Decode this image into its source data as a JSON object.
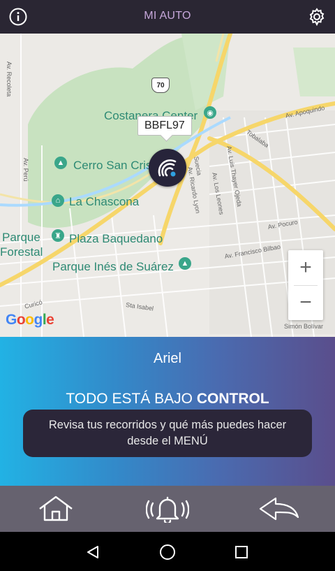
{
  "header": {
    "title": "MI AUTO",
    "info_icon": "info-icon",
    "settings_icon": "gear-icon"
  },
  "map": {
    "vehicle_plate": "BBFL97",
    "route_shield": "70",
    "pois": {
      "costanera": "Costanera Center",
      "cerro": "Cerro San Cristóbal",
      "chascona": "La Chascona",
      "parque_forestal_1": "Parque",
      "parque_forestal_2": "Forestal",
      "plaza": "Plaza Baquedano",
      "parque_ines": "Parque Inés de Suárez"
    },
    "streets": {
      "recoleta": "Av. Recoleta",
      "peru": "Av. Perú",
      "apoquindo": "Av. Apoquindo",
      "tobalaba": "Tobalaba",
      "suecia": "Suecia",
      "ricardo_lyon": "Av. Ricardo Lyon",
      "los_leones": "Av. Los Leones",
      "thayer": "Av. Luis Thayer Ojeda",
      "pocuro": "Av. Pocuro",
      "bilbao": "Av. Francisco Bilbao",
      "curico": "Curicó",
      "sta_isabel": "Sta Isabel",
      "simon_bolivar": "Simón Bolívar"
    },
    "zoom_in": "+",
    "zoom_out": "−",
    "attribution": "Google",
    "brand_colors": [
      "#4285F4",
      "#EA4335",
      "#FBBC05",
      "#4285F4",
      "#34A853",
      "#EA4335"
    ]
  },
  "panel": {
    "driver_name": "Ariel",
    "status_prefix": "TODO ESTÁ BAJO ",
    "status_emphasis": "CONTROL",
    "tip_line1": "Revisa tus recorridos y qué más puedes hacer",
    "tip_line2": "desde el MENÚ"
  },
  "bottom_nav": [
    "home-icon",
    "alarm-bell-icon",
    "back-arrow-icon"
  ],
  "system_nav": [
    "back-triangle-icon",
    "home-circle-icon",
    "recents-square-icon"
  ],
  "colors": {
    "header_bg": "#2a2633",
    "header_title": "#c6a7da",
    "panel_gradient_start": "#22b2e4",
    "panel_gradient_end": "#5a4e8c",
    "tip_bg": "#2b2639",
    "nav_bg": "#66626f"
  }
}
